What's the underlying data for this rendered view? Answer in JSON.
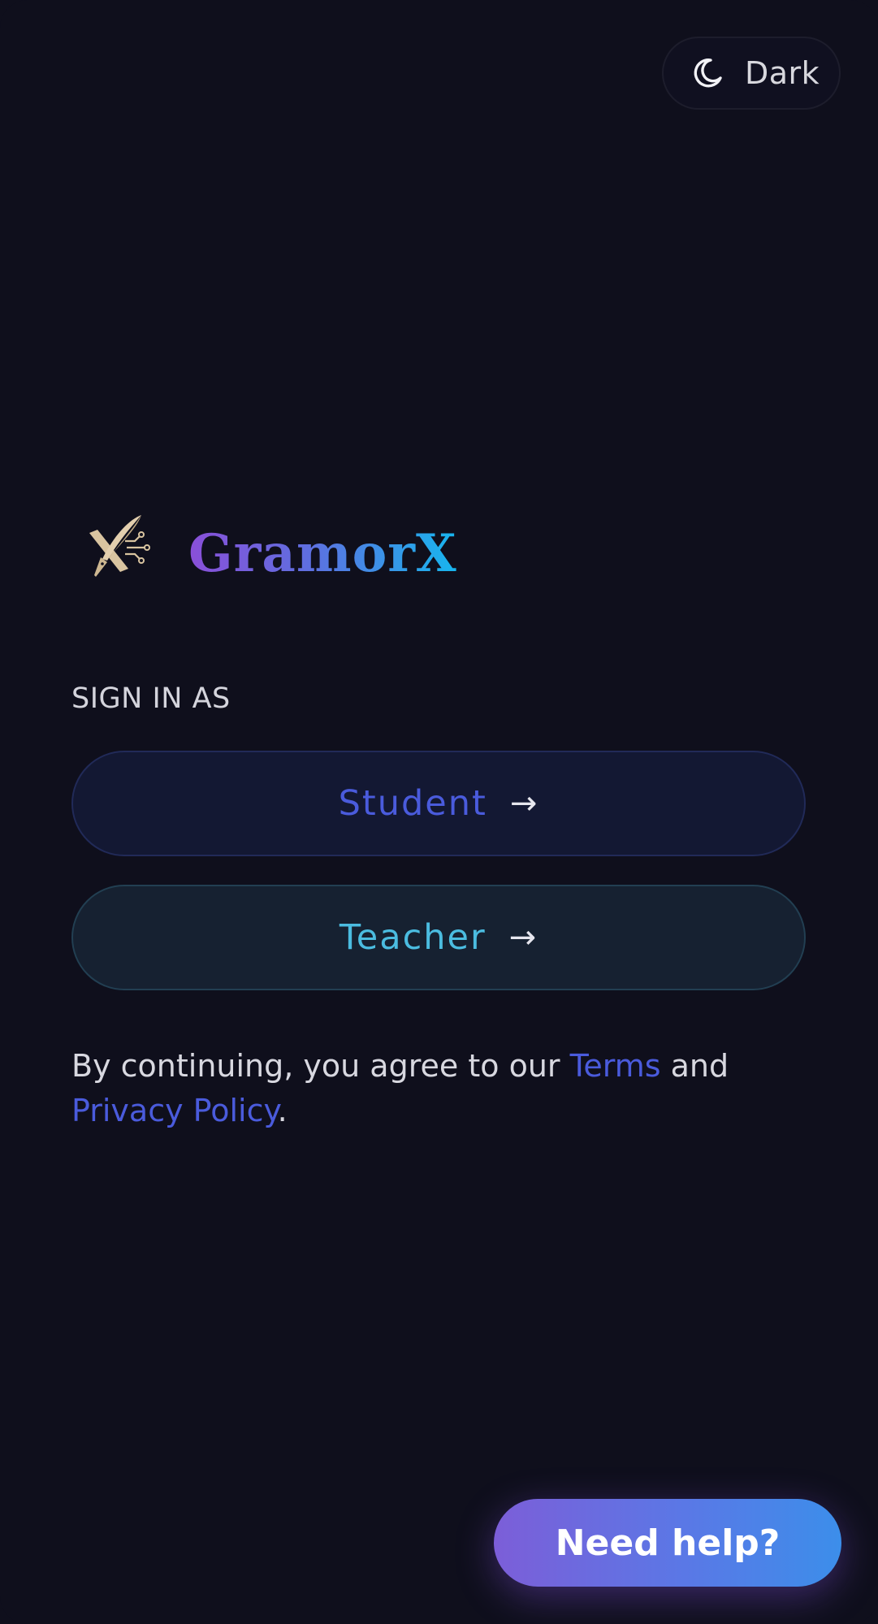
{
  "theme_toggle": {
    "icon": "moon-icon",
    "label": "Dark"
  },
  "brand": {
    "logo_icon": "quill-x-logo",
    "name": "GramorX",
    "gradient": [
      "#8a4fd8",
      "#5e6fe0",
      "#17b6ee"
    ]
  },
  "sign_in": {
    "heading": "SIGN IN AS",
    "roles": [
      {
        "label": "Student",
        "arrow": "→",
        "color": "#4a5bdc"
      },
      {
        "label": "Teacher",
        "arrow": "→",
        "color": "#4bbce0"
      }
    ]
  },
  "legal": {
    "prefix": "By continuing, you agree to our ",
    "terms_link": "Terms",
    "conjunction": " and",
    "privacy_link": "Privacy Policy",
    "suffix": "."
  },
  "help": {
    "label": "Need help?"
  },
  "colors": {
    "background": "#0f0f1c",
    "link": "#4a5bdc"
  }
}
